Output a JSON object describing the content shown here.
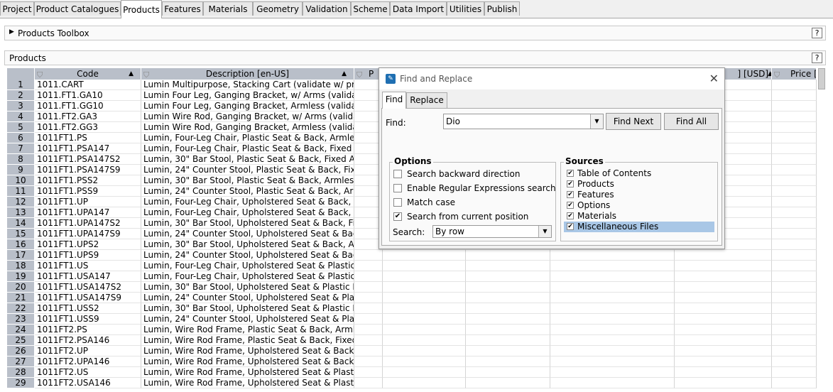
{
  "tabs": [
    "Project",
    "Product Catalogues",
    "Products",
    "Features",
    "Materials",
    "Geometry",
    "Validation",
    "Scheme",
    "Data Import",
    "Utilities",
    "Publish"
  ],
  "active_tab": "Products",
  "toolbox": {
    "title": "Products Toolbox",
    "expander": "▶",
    "help": "?"
  },
  "products_panel": {
    "title": "Products",
    "help": "?"
  },
  "grid": {
    "columns": [
      "Code",
      "Description [en-US]",
      "P",
      "] [USD]",
      "Price ["
    ],
    "rows": [
      [
        "1",
        "1011.CART",
        "Lumin Multipurpose, Stacking Cart (validate w/ pric"
      ],
      [
        "2",
        "1011.FT1.GA10",
        "Lumin Four Leg, Ganging Bracket,  w/ Arms (valida"
      ],
      [
        "3",
        "1011.FT1.GG10",
        "Lumin Four Leg, Ganging Bracket, Armless (validat"
      ],
      [
        "4",
        "1011.FT2.GA3",
        "Lumin Wire Rod, Ganging Bracket,  w/ Arms (valida"
      ],
      [
        "5",
        "1011.FT2.GG3",
        "Lumin Wire Rod, Ganging Bracket, Armless (validat"
      ],
      [
        "6",
        "1011FT1.PS",
        "Lumin, Four-Leg Chair, Plastic Seat & Back, Armles"
      ],
      [
        "7",
        "1011FT1.PSA147",
        "Lumin, Four-Leg Chair, Plastic Seat & Back, Fixed A"
      ],
      [
        "8",
        "1011FT1.PSA147S2",
        "Lumin, 30\" Bar Stool, Plastic Seat & Back, Fixed A1"
      ],
      [
        "9",
        "1011FT1.PSA147S9",
        "Lumin, 24\" Counter Stool, Plastic Seat & Back, Fixe"
      ],
      [
        "10",
        "1011FT1.PSS2",
        "Lumin, 30\" Bar Stool, Plastic Seat & Back, Armless"
      ],
      [
        "11",
        "1011FT1.PSS9",
        "Lumin, 24\" Counter Stool, Plastic Seat & Back, Arm"
      ],
      [
        "12",
        "1011FT1.UP",
        "Lumin, Four-Leg Chair, Upholstered Seat & Back, A"
      ],
      [
        "13",
        "1011FT1.UPA147",
        "Lumin, Four-Leg Chair, Upholstered Seat & Back, F"
      ],
      [
        "14",
        "1011FT1.UPA147S2",
        "Lumin, 30\" Bar Stool, Upholstered Seat & Back, Fix"
      ],
      [
        "15",
        "1011FT1.UPA147S9",
        "Lumin, 24\" Counter Stool, Upholstered Seat & Back"
      ],
      [
        "16",
        "1011FT1.UPS2",
        "Lumin, 30\" Bar Stool, Upholstered Seat & Back, Arr"
      ],
      [
        "17",
        "1011FT1.UPS9",
        "Lumin, 24\" Counter Stool, Upholstered Seat & Back"
      ],
      [
        "18",
        "1011FT1.US",
        "Lumin, Four-Leg Chair, Upholstered Seat & Plastic E"
      ],
      [
        "19",
        "1011FT1.USA147",
        "Lumin, Four-Leg Chair, Upholstered Seat & Plastic E"
      ],
      [
        "20",
        "1011FT1.USA147S2",
        "Lumin, 30\" Bar Stool, Upholstered Seat & Plastic Ba"
      ],
      [
        "21",
        "1011FT1.USA147S9",
        "Lumin, 24\" Counter Stool, Upholstered Seat & Plast"
      ],
      [
        "22",
        "1011FT1.USS2",
        "Lumin, 30\" Bar Stool, Upholstered Seat & Plastic Ba"
      ],
      [
        "23",
        "1011FT1.USS9",
        "Lumin, 24\" Counter Stool, Upholstered Seat & Plast"
      ],
      [
        "24",
        "1011FT2.PS",
        "Lumin, Wire Rod Frame, Plastic Seat & Back, Armle"
      ],
      [
        "25",
        "1011FT2.PSA146",
        "Lumin, Wire Rod Frame, Plastic Seat & Back, Fixed"
      ],
      [
        "26",
        "1011FT2.UP",
        "Lumin, Wire Rod Frame, Upholstered Seat & Back,"
      ],
      [
        "27",
        "1011FT2.UPA146",
        "Lumin, Wire Rod Frame, Upholstered Seat & Back,"
      ],
      [
        "28",
        "1011FT2.US",
        "Lumin, Wire Rod Frame, Upholstered Seat & Plastic"
      ],
      [
        "29",
        "1011FT2.USA146",
        "Lumin, Wire Rod Frame, Upholstered Seat & Plastic"
      ]
    ]
  },
  "dialog": {
    "title": "Find and Replace",
    "close": "✕",
    "tabs": [
      "Find",
      "Replace"
    ],
    "find_label": "Find:",
    "find_value": "Dio",
    "find_next": "Find Next",
    "find_all": "Find All",
    "options_title": "Options",
    "options": [
      {
        "label": "Search backward direction",
        "checked": false
      },
      {
        "label": "Enable Regular Expressions search",
        "checked": false
      },
      {
        "label": "Match case",
        "checked": false
      },
      {
        "label": "Search from current position",
        "checked": true
      }
    ],
    "search_label": "Search:",
    "search_value": "By row",
    "sources_title": "Sources",
    "sources": [
      {
        "label": "Table of Contents",
        "checked": true
      },
      {
        "label": "Products",
        "checked": true
      },
      {
        "label": "Features",
        "checked": true
      },
      {
        "label": "Options",
        "checked": true
      },
      {
        "label": "Materials",
        "checked": true
      },
      {
        "label": "Miscellaneous Files",
        "checked": true,
        "selected": true
      }
    ],
    "check_glyph": "✔",
    "dropdown_glyph": "▼"
  },
  "glyphs": {
    "funnel": "⛉",
    "sort_up": "▲"
  }
}
